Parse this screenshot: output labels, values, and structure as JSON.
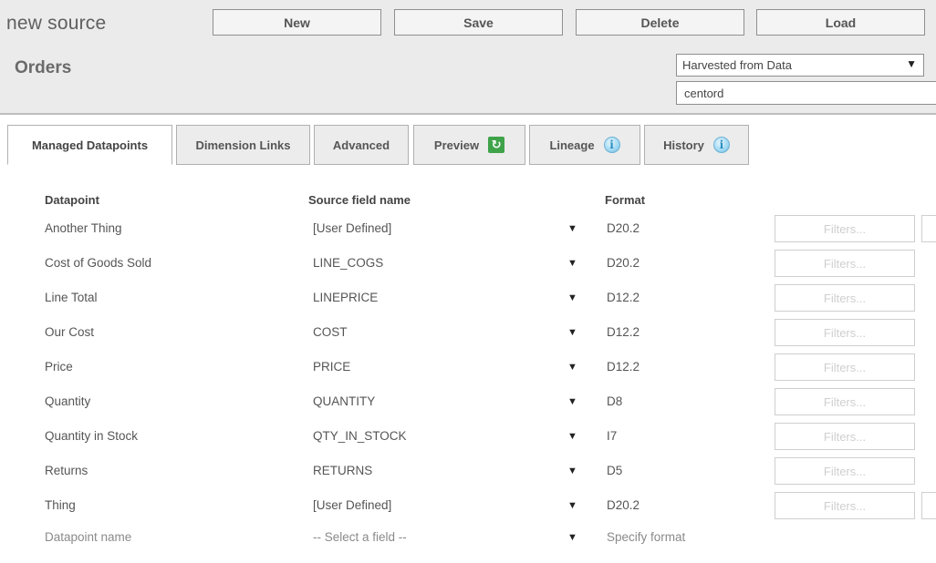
{
  "header": {
    "source_label": "new source",
    "source_name": "Orders",
    "buttons": {
      "new": "New",
      "save": "Save",
      "delete": "Delete",
      "load": "Load"
    },
    "origin_select": "Harvested from Data",
    "table_field": "centord"
  },
  "tabs": [
    {
      "label": "Managed Datapoints",
      "active": true
    },
    {
      "label": "Dimension Links"
    },
    {
      "label": "Advanced"
    },
    {
      "label": "Preview",
      "icon": "refresh-icon"
    },
    {
      "label": "Lineage",
      "icon": "info-icon"
    },
    {
      "label": "History",
      "icon": "info-icon"
    }
  ],
  "grid": {
    "headers": {
      "datapoint": "Datapoint",
      "source_field": "Source field name",
      "format": "Format"
    },
    "filters_label": "Filters...",
    "rows": [
      {
        "datapoint": "Another Thing",
        "source_field": "[User Defined]",
        "format": "D20.2"
      },
      {
        "datapoint": "Cost of Goods Sold",
        "source_field": "LINE_COGS",
        "format": "D20.2"
      },
      {
        "datapoint": "Line Total",
        "source_field": "LINEPRICE",
        "format": "D12.2"
      },
      {
        "datapoint": "Our Cost",
        "source_field": "COST",
        "format": "D12.2"
      },
      {
        "datapoint": "Price",
        "source_field": "PRICE",
        "format": "D12.2"
      },
      {
        "datapoint": "Quantity",
        "source_field": "QUANTITY",
        "format": "D8"
      },
      {
        "datapoint": "Quantity in Stock",
        "source_field": "QTY_IN_STOCK",
        "format": "I7"
      },
      {
        "datapoint": "Returns",
        "source_field": "RETURNS",
        "format": "D5"
      },
      {
        "datapoint": "Thing",
        "source_field": "[User Defined]",
        "format": "D20.2"
      }
    ],
    "new_row": {
      "datapoint_placeholder": "Datapoint name",
      "source_field_placeholder": "-- Select a field --",
      "format_placeholder": "Specify format"
    }
  }
}
